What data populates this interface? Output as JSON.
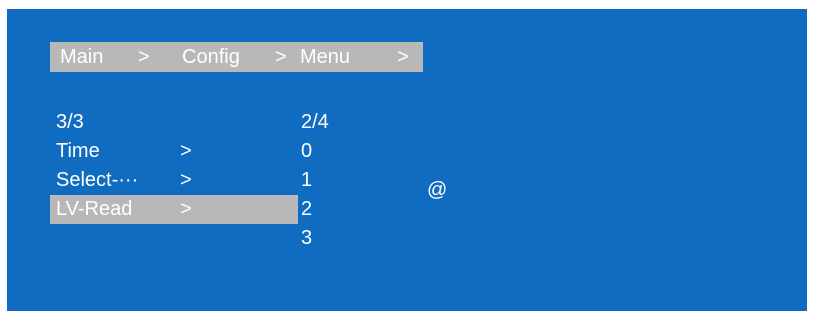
{
  "breadcrumb": {
    "items": [
      "Main",
      ">",
      "Config",
      ">",
      "Menu",
      ">"
    ]
  },
  "menu": {
    "page_indicator": "3/3",
    "items": [
      {
        "label": "Time",
        "arrow": ">"
      },
      {
        "label": "Select-···",
        "arrow": ">"
      },
      {
        "label": "LV-Read",
        "arrow": ">",
        "selected": true
      }
    ]
  },
  "values": {
    "page_indicator": "2/4",
    "items": [
      "0",
      "1",
      "2",
      "3"
    ]
  },
  "marker": "@",
  "colors": {
    "background": "#0f6cc0",
    "highlight": "#b8b8b8",
    "text": "#ffffff"
  }
}
